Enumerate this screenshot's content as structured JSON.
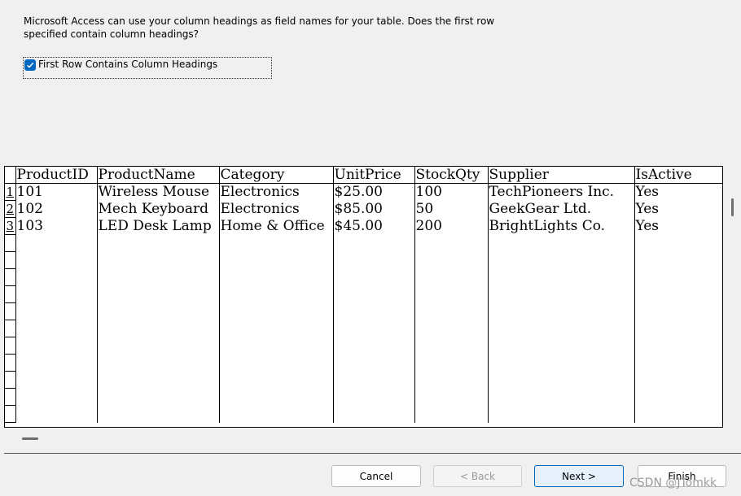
{
  "intro": {
    "line1": "Microsoft Access can use your column headings as field names for your table. Does the first row",
    "line2": "specified contain column headings?"
  },
  "checkbox": {
    "label": "First Row Contains Column Headings",
    "checked": true
  },
  "grid": {
    "columns": [
      "ProductID",
      "ProductName",
      "Category",
      "UnitPrice",
      "StockQty",
      "Supplier",
      "IsActive"
    ],
    "rows": [
      {
        "num": "1",
        "cells": [
          "101",
          "Wireless Mouse",
          "Electronics",
          "$25.00",
          "100",
          "TechPioneers Inc.",
          "Yes"
        ]
      },
      {
        "num": "2",
        "cells": [
          "102",
          "Mech Keyboard",
          "Electronics",
          "$85.00",
          "50",
          "GeekGear Ltd.",
          "Yes"
        ]
      },
      {
        "num": "3",
        "cells": [
          "103",
          "LED Desk Lamp",
          "Home & Office",
          "$45.00",
          "200",
          "BrightLights Co.",
          "Yes"
        ]
      }
    ]
  },
  "buttons": {
    "cancel": "Cancel",
    "back": "< Back",
    "next": "Next >",
    "finish": "Finish"
  },
  "watermark": "CSDN @JTomkk",
  "colors": {
    "accent": "#0067c0"
  }
}
